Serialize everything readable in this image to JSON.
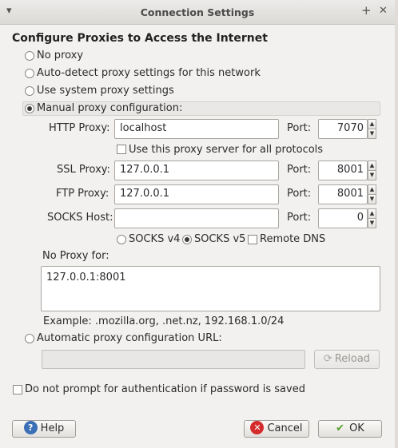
{
  "window": {
    "title": "Connection Settings"
  },
  "heading": "Configure Proxies to Access the Internet",
  "options": {
    "no_proxy": "No proxy",
    "auto_detect": "Auto-detect proxy settings for this network",
    "system": "Use system proxy settings",
    "manual": "Manual proxy configuration:",
    "auto_url": "Automatic proxy configuration URL:"
  },
  "http": {
    "label": "HTTP Proxy:",
    "value": "localhost",
    "port_label": "Port:",
    "port": "7070"
  },
  "use_all": "Use this proxy server for all protocols",
  "ssl": {
    "label": "SSL Proxy:",
    "value": "127.0.0.1",
    "port_label": "Port:",
    "port": "8001"
  },
  "ftp": {
    "label": "FTP Proxy:",
    "value": "127.0.0.1",
    "port_label": "Port:",
    "port": "8001"
  },
  "socks": {
    "label": "SOCKS Host:",
    "value": "",
    "port_label": "Port:",
    "port": "0",
    "v4": "SOCKS v4",
    "v5": "SOCKS v5",
    "remote_dns": "Remote DNS"
  },
  "no_proxy_for": {
    "label": "No Proxy for:",
    "value": "127.0.0.1:8001",
    "example": "Example: .mozilla.org, .net.nz, 192.168.1.0/24"
  },
  "auto_url": {
    "value": "",
    "reload": "Reload"
  },
  "no_prompt": "Do not prompt for authentication if password is saved",
  "buttons": {
    "help": "Help",
    "cancel": "Cancel",
    "ok": "OK"
  },
  "colors": {
    "accent": "#3b6fb6",
    "cancel": "#d42c2c",
    "ok": "#5aa02c"
  }
}
